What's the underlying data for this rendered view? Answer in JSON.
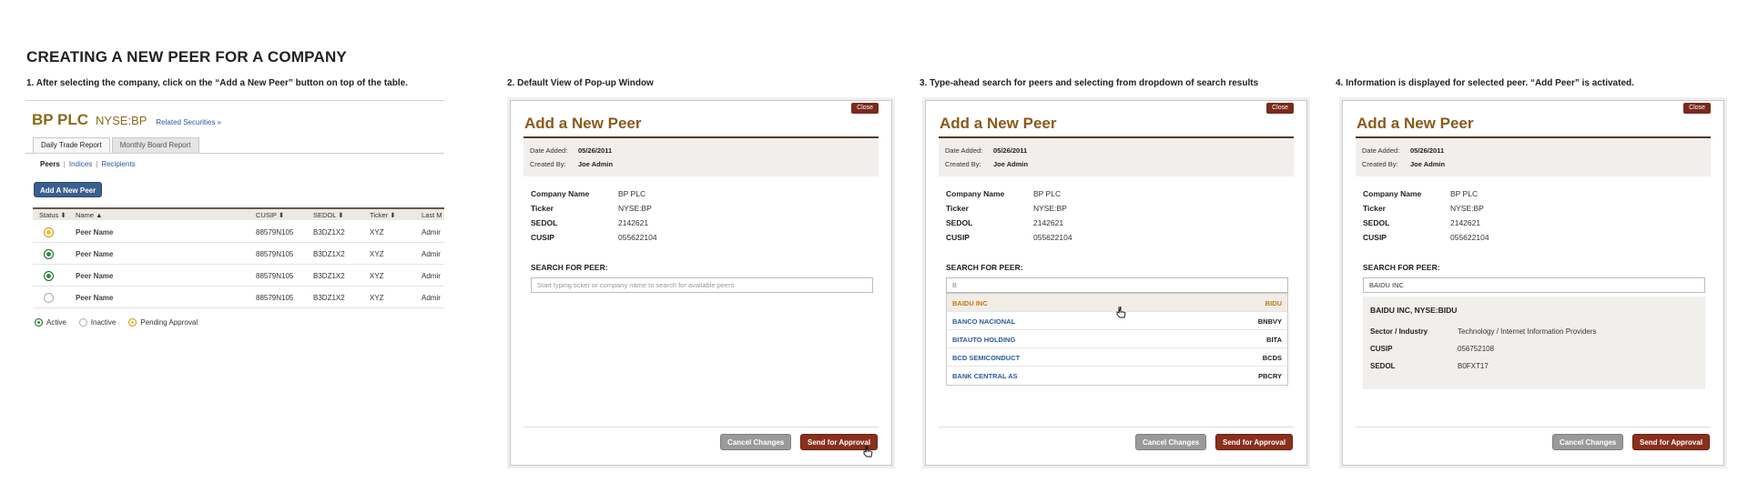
{
  "page_title": "CREATING A NEW PEER FOR A COMPANY",
  "steps": [
    "1. After selecting the company, click on the “Add a New Peer” button on top of the table.",
    "2. Default View of Pop-up Window",
    "3. Type-ahead search for peers and selecting from dropdown of search results",
    "4. Information is displayed for selected peer. “Add Peer” is activated."
  ],
  "panel1": {
    "company": "BP PLC",
    "ticker": "NYSE:BP",
    "related_link": "Related Securities »",
    "tabs": [
      "Daily Trade Report",
      "Monthly Board Report"
    ],
    "subnav": [
      "Peers",
      "Indices",
      "Recipients"
    ],
    "add_button": "Add A New Peer",
    "columns": [
      "Status ⬍",
      "Name ▲",
      "CUSIP ⬍",
      "SEDOL ⬍",
      "Ticker ⬍",
      "Last M"
    ],
    "rows": [
      {
        "status": "pending",
        "name": "Peer Name",
        "cusip": "88579N105",
        "sedol": "B3DZ1X2",
        "ticker": "XYZ",
        "last": "Admir"
      },
      {
        "status": "active",
        "name": "Peer Name",
        "cusip": "88579N105",
        "sedol": "B3DZ1X2",
        "ticker": "XYZ",
        "last": "Admir"
      },
      {
        "status": "active",
        "name": "Peer Name",
        "cusip": "88579N105",
        "sedol": "B3DZ1X2",
        "ticker": "XYZ",
        "last": "Admir"
      },
      {
        "status": "inactive",
        "name": "Peer Name",
        "cusip": "88579N105",
        "sedol": "B3DZ1X2",
        "ticker": "XYZ",
        "last": "Admir"
      }
    ],
    "legend": [
      "Active",
      "Inactive",
      "Pending Approval"
    ]
  },
  "modal": {
    "close": "Close",
    "title": "Add a New Peer",
    "date_added_label": "Date Added:",
    "date_added": "05/26/2011",
    "created_by_label": "Created By:",
    "created_by": "Joe Admin",
    "fields": [
      {
        "label": "Company Name",
        "value": "BP PLC"
      },
      {
        "label": "Ticker",
        "value": "NYSE:BP"
      },
      {
        "label": "SEDOL",
        "value": "2142621"
      },
      {
        "label": "CUSIP",
        "value": "055622104"
      }
    ],
    "search_label": "SEARCH FOR PEER:",
    "search_placeholder": "Start typing ticker or company name to search for available peers",
    "cancel": "Cancel Changes",
    "send": "Send for Approval"
  },
  "panel3": {
    "search_value": "B",
    "results": [
      {
        "name": "BAIDU INC",
        "ticker": "BIDU"
      },
      {
        "name": "BANCO NACIONAL",
        "ticker": "BNBVY"
      },
      {
        "name": "BITAUTO HOLDING",
        "ticker": "BITA"
      },
      {
        "name": "BCD SEMICONDUCT",
        "ticker": "BCDS"
      },
      {
        "name": "BANK CENTRAL AS",
        "ticker": "PBCRY"
      }
    ]
  },
  "panel4": {
    "search_value": "BAIDU INC",
    "result_title": "BAIDU INC, NYSE:BIDU",
    "result_fields": [
      {
        "label": "Sector / Industry",
        "value": "Technology / Internet Information Providers"
      },
      {
        "label": "CUSIP",
        "value": "056752108"
      },
      {
        "label": "SEDOL",
        "value": "B0FXT17"
      }
    ]
  },
  "colors": {
    "brand_brown": "#8a5a1a",
    "primary_button": "#8a2f1c",
    "secondary_button": "#9a9a9a",
    "add_button_blue": "#3a5f8c",
    "link_blue": "#2a5aa0"
  }
}
